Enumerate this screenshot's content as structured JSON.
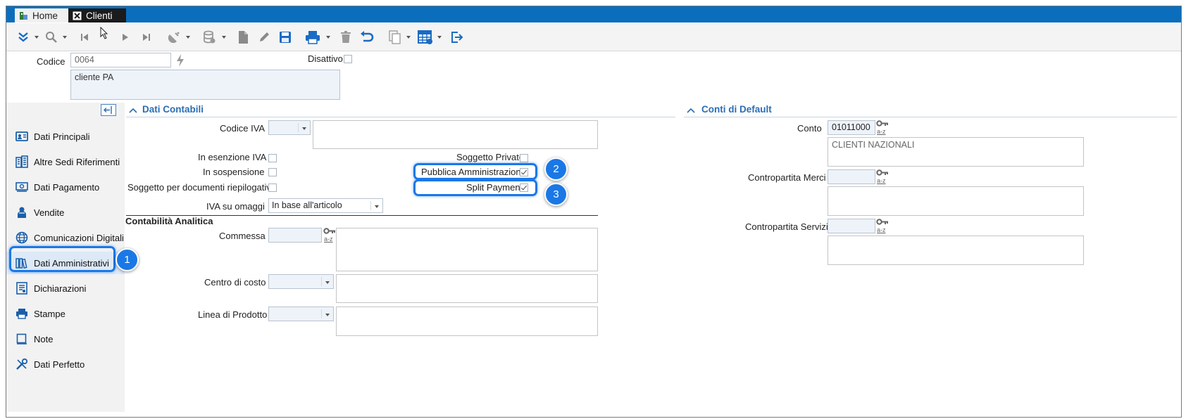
{
  "tabs": [
    {
      "label": "Home",
      "icon": "home-icon"
    },
    {
      "label": "Clienti",
      "icon": "excel-icon"
    }
  ],
  "toolbar": {
    "buttons": [
      "expand-icon",
      "search-icon",
      "first-record-icon",
      "pointer-icon",
      "next-record-icon",
      "last-record-icon",
      "satellite-icon",
      "database-icon",
      "new-document-icon",
      "edit-icon",
      "save-icon",
      "print-icon",
      "delete-icon",
      "undo-icon",
      "copy-icon",
      "calendar-grid-icon",
      "exit-icon"
    ]
  },
  "header": {
    "codice_label": "Codice",
    "codice_value": "0064",
    "description": "cliente PA",
    "disattivo_label": "Disattivo"
  },
  "sidebar": {
    "items": [
      {
        "label": "Dati Principali",
        "icon": "id-card-icon"
      },
      {
        "label": "Altre Sedi Riferimenti",
        "icon": "buildings-icon"
      },
      {
        "label": "Dati Pagamento",
        "icon": "payment-icon"
      },
      {
        "label": "Vendite",
        "icon": "sales-icon"
      },
      {
        "label": "Comunicazioni Digitali",
        "icon": "globe-icon"
      },
      {
        "label": "Dati Amministrativi",
        "icon": "books-icon"
      },
      {
        "label": "Dichiarazioni",
        "icon": "declaration-icon"
      },
      {
        "label": "Stampe",
        "icon": "printer-icon"
      },
      {
        "label": "Note",
        "icon": "note-icon"
      },
      {
        "label": "Dati Perfetto",
        "icon": "tools-icon"
      }
    ],
    "selected": "Dati Amministrativi"
  },
  "dati_contabili": {
    "title": "Dati Contabili",
    "codice_iva_label": "Codice IVA",
    "codice_iva_value": "",
    "esenzione_label": "In esenzione IVA",
    "sospensione_label": "In sospensione",
    "riepilogativi_label": "Soggetto per documenti riepilogativi",
    "soggetto_privato_label": "Soggetto Privato",
    "pubblica_amm_label": "Pubblica Amministrazione",
    "pubblica_amm_checked": true,
    "split_payment_label": "Split Payment",
    "split_payment_checked": true,
    "iva_omaggi_label": "IVA su omaggi",
    "iva_omaggi_value": "In base all'articolo"
  },
  "contabilita_analitica": {
    "title": "Contabilità Analitica",
    "commessa_label": "Commessa",
    "centro_costo_label": "Centro di costo",
    "linea_prodotto_label": "Linea di Prodotto"
  },
  "conti_default": {
    "title": "Conti di Default",
    "conto_label": "Conto",
    "conto_value": "01011000",
    "conto_description": "CLIENTI NAZIONALI",
    "merci_label": "Contropartita Merci",
    "servizi_label": "Contropartita Servizi"
  },
  "lookup_label": "a-z",
  "callouts": [
    "1",
    "2",
    "3"
  ],
  "colors": {
    "titlebar": "#0a6ebd",
    "accent": "#2a6db5",
    "highlight": "#1a78e6"
  }
}
